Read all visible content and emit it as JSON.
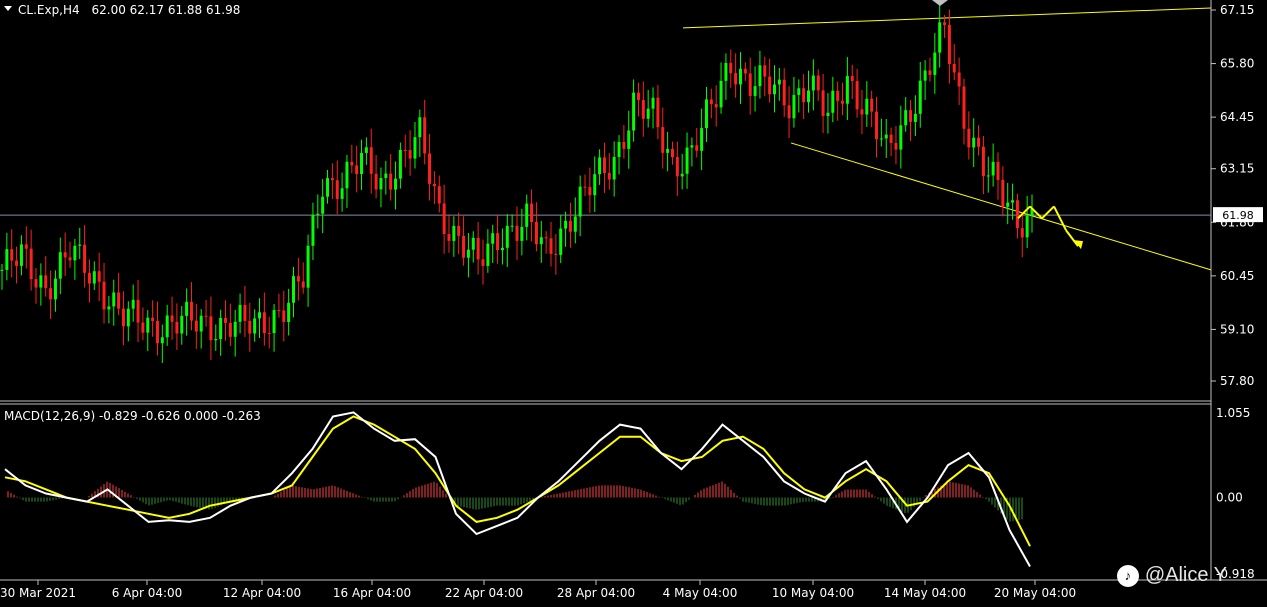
{
  "header": {
    "symbol_timeframe": "CL.Exp,H4",
    "ohlc": "62.00 62.17 61.88 61.98"
  },
  "price_axis": {
    "ticks": [
      "67.15",
      "65.80",
      "64.45",
      "63.15",
      "61.80",
      "60.45",
      "59.10",
      "57.80"
    ],
    "current_price": "61.98"
  },
  "macd_panel": {
    "label": "MACD(12,26,9) -0.829 -0.626 0.000 -0.263",
    "ticks": [
      "1.055",
      "0.00",
      "-0.918"
    ]
  },
  "time_axis": {
    "ticks": [
      "30 Mar 2021",
      "6 Apr 04:00",
      "12 Apr 04:00",
      "16 Apr 04:00",
      "22 Apr 04:00",
      "28 Apr 04:00",
      "4 May 04:00",
      "10 May 04:00",
      "14 May 04:00",
      "20 May 04:00"
    ]
  },
  "watermark": "@Alice Y",
  "colors": {
    "background": "#000000",
    "bull_candle": "#00ff00",
    "bear_candle": "#ff2020",
    "trendline": "#ffff00",
    "macd_line": "#ffffff",
    "signal_line": "#ffff00",
    "hist_positive": "#ff4040",
    "hist_negative": "#2f8f2f",
    "axis_text": "#ffffff",
    "current_price_line": "#8a8aa8"
  },
  "chart_data": [
    {
      "type": "candlestick",
      "title": "CL.Exp,H4",
      "y_range": [
        57.2,
        67.3
      ],
      "current_price": 61.98,
      "close_path": [
        {
          "t": 0,
          "close": 60.6
        },
        {
          "t": 4,
          "close": 60.9
        },
        {
          "t": 9,
          "close": 60.2
        },
        {
          "t": 14,
          "close": 61.0
        },
        {
          "t": 20,
          "close": 60.3
        },
        {
          "t": 25,
          "close": 59.4
        },
        {
          "t": 30,
          "close": 59.2
        },
        {
          "t": 36,
          "close": 59.3
        },
        {
          "t": 41,
          "close": 59.2
        },
        {
          "t": 47,
          "close": 59.3
        },
        {
          "t": 52,
          "close": 59.1
        },
        {
          "t": 57,
          "close": 59.6
        },
        {
          "t": 62,
          "close": 60.3
        },
        {
          "t": 66,
          "close": 62.8
        },
        {
          "t": 70,
          "close": 62.9
        },
        {
          "t": 74,
          "close": 63.3
        },
        {
          "t": 78,
          "close": 62.8
        },
        {
          "t": 82,
          "close": 63.4
        },
        {
          "t": 86,
          "close": 63.9
        },
        {
          "t": 90,
          "close": 62.1
        },
        {
          "t": 94,
          "close": 61.4
        },
        {
          "t": 98,
          "close": 60.7
        },
        {
          "t": 103,
          "close": 61.6
        },
        {
          "t": 108,
          "close": 61.8
        },
        {
          "t": 112,
          "close": 61.0
        },
        {
          "t": 117,
          "close": 62.0
        },
        {
          "t": 122,
          "close": 62.8
        },
        {
          "t": 126,
          "close": 63.4
        },
        {
          "t": 130,
          "close": 64.8
        },
        {
          "t": 134,
          "close": 64.4
        },
        {
          "t": 138,
          "close": 63.3
        },
        {
          "t": 142,
          "close": 63.6
        },
        {
          "t": 146,
          "close": 64.6
        },
        {
          "t": 150,
          "close": 65.9
        },
        {
          "t": 154,
          "close": 65.3
        },
        {
          "t": 158,
          "close": 65.2
        },
        {
          "t": 162,
          "close": 64.9
        },
        {
          "t": 166,
          "close": 65.3
        },
        {
          "t": 170,
          "close": 64.4
        },
        {
          "t": 174,
          "close": 65.5
        },
        {
          "t": 178,
          "close": 64.6
        },
        {
          "t": 182,
          "close": 63.5
        },
        {
          "t": 186,
          "close": 64.5
        },
        {
          "t": 190,
          "close": 65.4
        },
        {
          "t": 194,
          "close": 66.6
        },
        {
          "t": 198,
          "close": 64.5
        },
        {
          "t": 202,
          "close": 63.2
        },
        {
          "t": 206,
          "close": 62.4
        },
        {
          "t": 209,
          "close": 61.9
        },
        {
          "t": 212,
          "close": 62.0
        }
      ],
      "trendlines": [
        {
          "name": "upper",
          "x": [
            "4 May 04:00",
            "end"
          ],
          "y": [
            66.7,
            67.2
          ]
        },
        {
          "name": "lower",
          "x": [
            "10 May 04:00",
            "end"
          ],
          "y": [
            63.8,
            60.6
          ]
        }
      ],
      "projection_path": [
        61.9,
        62.2,
        61.9,
        62.2,
        61.6,
        61.2
      ],
      "x_ticks": [
        "30 Mar 2021",
        "6 Apr 04:00",
        "12 Apr 04:00",
        "16 Apr 04:00",
        "22 Apr 04:00",
        "28 Apr 04:00",
        "4 May 04:00",
        "10 May 04:00",
        "14 May 04:00",
        "20 May 04:00"
      ],
      "y_ticks": [
        67.15,
        65.8,
        64.45,
        63.15,
        61.8,
        60.45,
        59.1,
        57.8
      ]
    },
    {
      "type": "line",
      "title": "MACD(12,26,9) -0.829 -0.626 0.000 -0.263",
      "y_range": [
        -0.918,
        1.055
      ],
      "series": [
        {
          "values": [
            0.35,
            0.15,
            0.05,
            0.0,
            -0.05,
            0.1,
            -0.1,
            -0.3,
            -0.28,
            -0.3,
            -0.25,
            -0.1,
            0.0,
            0.05,
            0.3,
            0.6,
            1.0,
            1.05,
            0.85,
            0.7,
            0.72,
            0.5,
            -0.2,
            -0.45,
            -0.35,
            -0.25,
            0.0,
            0.2,
            0.45,
            0.7,
            0.9,
            0.85,
            0.55,
            0.35,
            0.6,
            0.9,
            0.7,
            0.5,
            0.2,
            0.05,
            -0.05,
            0.3,
            0.45,
            0.1,
            -0.3,
            0.0,
            0.4,
            0.55,
            0.25,
            -0.4,
            -0.85
          ]
        },
        {
          "values": [
            0.25,
            0.2,
            0.1,
            0.0,
            -0.05,
            -0.1,
            -0.15,
            -0.2,
            -0.25,
            -0.2,
            -0.1,
            -0.05,
            0.0,
            0.05,
            0.15,
            0.5,
            0.85,
            1.0,
            0.9,
            0.75,
            0.6,
            0.3,
            -0.1,
            -0.3,
            -0.25,
            -0.15,
            0.0,
            0.15,
            0.35,
            0.55,
            0.75,
            0.75,
            0.55,
            0.45,
            0.5,
            0.7,
            0.75,
            0.6,
            0.3,
            0.1,
            0.0,
            0.2,
            0.35,
            0.2,
            -0.1,
            -0.05,
            0.2,
            0.4,
            0.3,
            -0.1,
            -0.6
          ]
        }
      ],
      "histogram": [
        0.1,
        -0.05,
        -0.05,
        0.0,
        0.0,
        0.2,
        0.05,
        -0.1,
        -0.03,
        -0.1,
        -0.15,
        -0.05,
        0.0,
        0.0,
        0.15,
        0.1,
        0.15,
        0.05,
        -0.05,
        -0.05,
        0.12,
        0.2,
        -0.1,
        -0.15,
        -0.1,
        -0.1,
        0.0,
        0.05,
        0.1,
        0.15,
        0.15,
        0.1,
        0.0,
        -0.1,
        0.1,
        0.2,
        -0.05,
        -0.1,
        -0.1,
        -0.05,
        -0.05,
        0.1,
        0.1,
        -0.1,
        -0.2,
        0.05,
        0.2,
        0.15,
        -0.05,
        -0.3,
        -0.25
      ],
      "y_ticks": [
        1.055,
        0.0,
        -0.918
      ]
    }
  ]
}
